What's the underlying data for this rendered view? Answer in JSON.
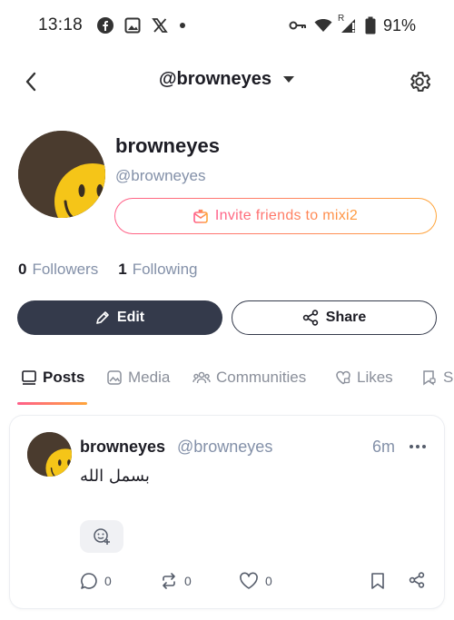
{
  "status_bar": {
    "time": "13:18",
    "left_icons": [
      "facebook-icon",
      "gallery-icon",
      "x-icon",
      "dot-icon"
    ],
    "right_icons": [
      "key-icon",
      "wifi-icon",
      "signal-icon",
      "battery-icon"
    ],
    "signal_roaming": "R",
    "battery": "91%"
  },
  "header": {
    "title": "@browneyes"
  },
  "profile": {
    "name": "browneyes",
    "handle": "@browneyes",
    "invite_label": "Invite friends to mixi2",
    "followers_count": "0",
    "followers_label": "Followers",
    "following_count": "1",
    "following_label": "Following",
    "edit_label": "Edit",
    "share_label": "Share"
  },
  "tabs": [
    {
      "label": "Posts",
      "icon": "posts-icon",
      "active": true
    },
    {
      "label": "Media",
      "icon": "media-icon",
      "active": false
    },
    {
      "label": "Communities",
      "icon": "communities-icon",
      "active": false
    },
    {
      "label": "Likes",
      "icon": "likes-icon",
      "active": false
    },
    {
      "label": "S",
      "icon": "saved-icon",
      "active": false
    }
  ],
  "post": {
    "author": "browneyes",
    "handle": "@browneyes",
    "time": "6m",
    "body": "بسمل الله",
    "reply_count": "0",
    "repost_count": "0",
    "like_count": "0"
  },
  "colors": {
    "primary_dark": "#343a4b",
    "accent_gradient_start": "#ff5f8a",
    "accent_gradient_end": "#ffa53a",
    "muted_text": "#8390a8",
    "avatar_bg": "#4a3b2e",
    "smiley": "#f5c518"
  }
}
